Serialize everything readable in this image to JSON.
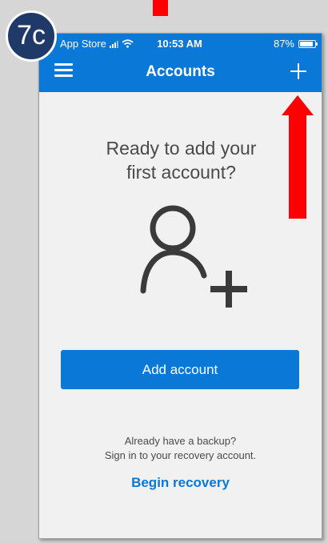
{
  "badge": {
    "label": "7c"
  },
  "status_bar": {
    "carrier": "App Store",
    "time": "10:53 AM",
    "battery": "87%",
    "battery_level": 0.87
  },
  "header": {
    "title": "Accounts"
  },
  "main": {
    "headline_line1": "Ready to add your",
    "headline_line2": "first account?",
    "add_account_label": "Add account",
    "backup_line1": "Already have a backup?",
    "backup_line2": "Sign in to your recovery account.",
    "begin_recovery_label": "Begin recovery"
  },
  "icons": {
    "menu": "hamburger-menu-icon",
    "add": "plus-icon",
    "person": "person-add-icon",
    "wifi": "wifi-icon",
    "signal": "signal-icon",
    "battery": "battery-icon",
    "arrow": "red-up-arrow-icon"
  },
  "colors": {
    "accent": "#0a78d7",
    "badge": "#1f3a68",
    "arrow": "#ff0000",
    "text": "#4a4a4a"
  }
}
